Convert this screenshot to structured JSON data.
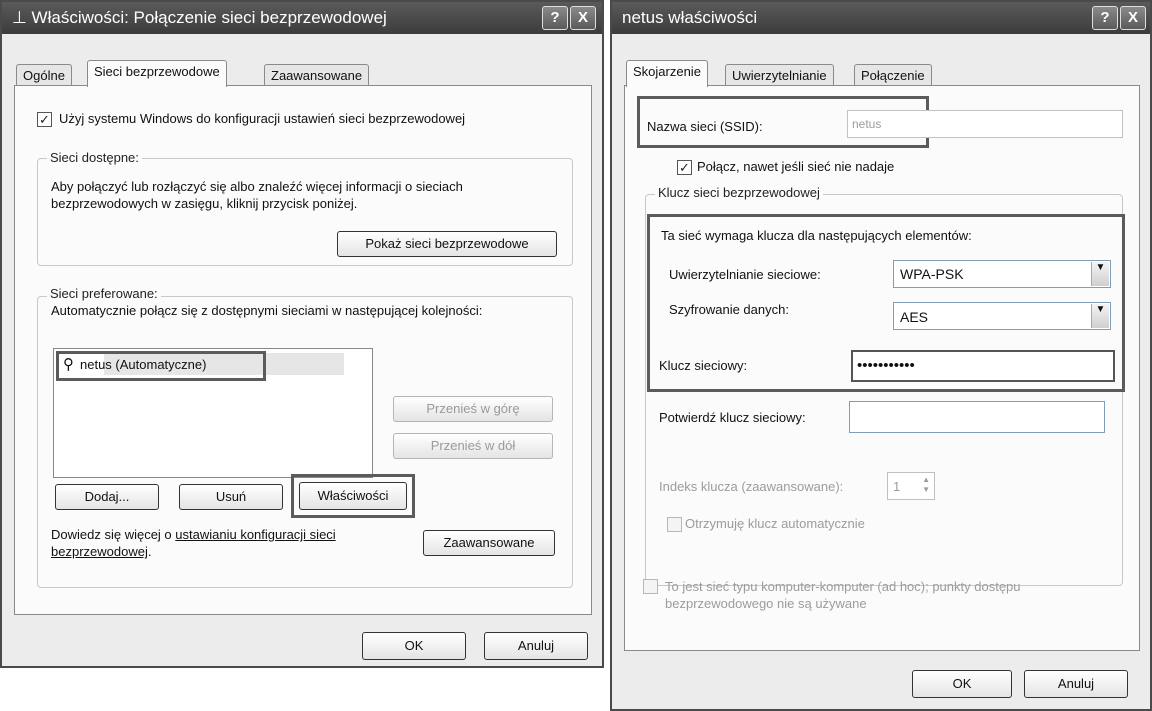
{
  "left_window": {
    "title": "Właściwości: Połączenie sieci bezprzewodowej",
    "help_btn": "?",
    "close_btn": "X",
    "tabs": [
      "Ogólne",
      "Sieci bezprzewodowe",
      "Zaawansowane"
    ],
    "use_windows_checkbox": "Użyj systemu Windows do konfiguracji ustawień sieci bezprzewodowej",
    "available": {
      "legend": "Sieci dostępne:",
      "description": "Aby połączyć lub rozłączyć się albo znaleźć więcej informacji o sieciach bezprzewodowych w zasięgu, kliknij przycisk poniżej.",
      "show_button": "Pokaż sieci bezprzewodowe"
    },
    "preferred": {
      "legend": "Sieci preferowane:",
      "description": "Automatycznie połącz się z dostępnymi sieciami w następującej kolejności:",
      "list_items": [
        "netus (Automatyczne)"
      ],
      "move_up": "Przenieś w górę",
      "move_down": "Przenieś w dół",
      "add": "Dodaj...",
      "remove": "Usuń",
      "properties": "Właściwości"
    },
    "learn_prefix": "Dowiedz się więcej o ",
    "learn_link": "ustawianiu konfiguracji sieci bezprzewodowej",
    "learn_suffix": ".",
    "advanced_button": "Zaawansowane",
    "ok": "OK",
    "cancel": "Anuluj"
  },
  "right_window": {
    "title": "netus właściwości",
    "help_btn": "?",
    "close_btn": "X",
    "tabs": [
      "Skojarzenie",
      "Uwierzytelnianie",
      "Połączenie"
    ],
    "ssid_label": "Nazwa sieci (SSID):",
    "ssid_value": "netus",
    "connect_checkbox": "Połącz, nawet jeśli sieć nie nadaje",
    "key_group": "Klucz sieci bezprzewodowej",
    "key_required": "Ta sieć wymaga klucza dla następujących elementów:",
    "auth_label": "Uwierzytelnianie sieciowe:",
    "auth_value": "WPA-PSK",
    "encryption_label": "Szyfrowanie danych:",
    "encryption_value": "AES",
    "key_label": "Klucz sieciowy:",
    "key_value": "•••••••••••",
    "confirm_label": "Potwierdź klucz sieciowy:",
    "confirm_value": "",
    "key_index_label": "Indeks klucza (zaawansowane):",
    "key_index_value": "1",
    "auto_key_checkbox": "Otrzymuję klucz automatycznie",
    "adhoc_checkbox": "To jest sieć typu komputer-komputer (ad hoc); punkty dostępu bezprzewodowego nie są używane",
    "ok": "OK",
    "cancel": "Anuluj"
  }
}
